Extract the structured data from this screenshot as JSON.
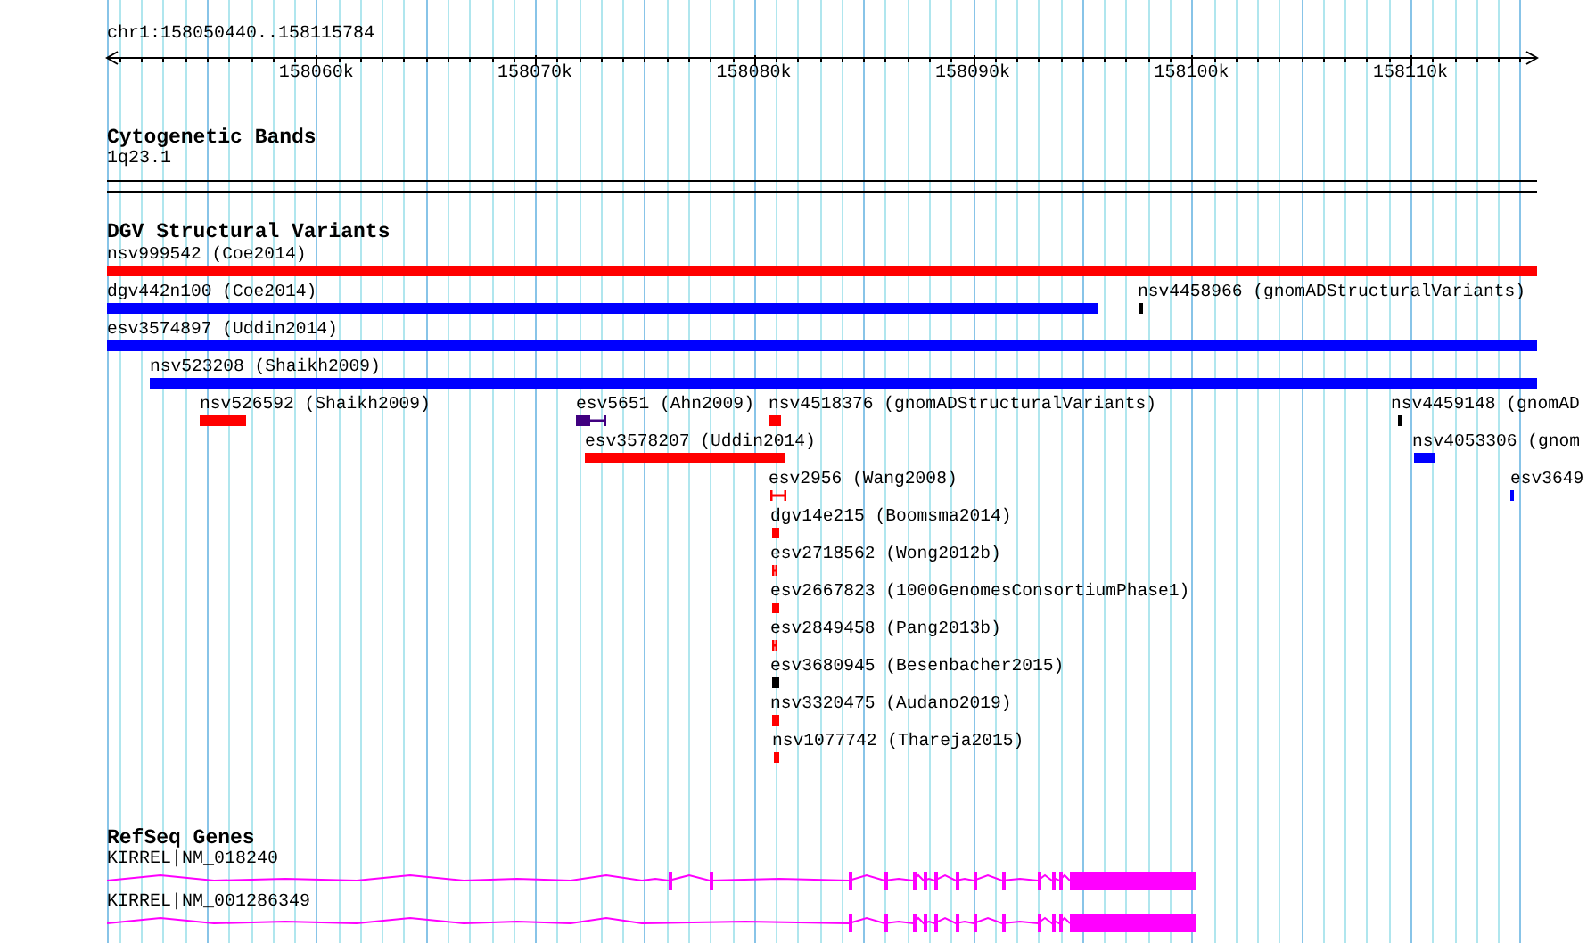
{
  "ruler": {
    "location": "chr1:158050440..158115784",
    "ticks": [
      "158060k",
      "158070k",
      "158080k",
      "158090k",
      "158100k",
      "158110k"
    ]
  },
  "tracks": [
    {
      "title": "Cytogenetic Bands",
      "kind": "bands",
      "features": [
        {
          "label": "1q23.1"
        }
      ]
    },
    {
      "title": "DGV Structural Variants",
      "kind": "variants",
      "features": [
        {
          "label": "nsv999542 (Coe2014)",
          "color": "#ff0000"
        },
        {
          "label": "dgv442n100 (Coe2014)",
          "color": "#0000ff"
        },
        {
          "label": "nsv4458966 (gnomADStructuralVariants)",
          "color": "#000000"
        },
        {
          "label": "esv3574897 (Uddin2014)",
          "color": "#0000ff"
        },
        {
          "label": "nsv523208 (Shaikh2009)",
          "color": "#0000ff"
        },
        {
          "label": "nsv526592 (Shaikh2009)",
          "color": "#ff0000"
        },
        {
          "label": "esv5651 (Ahn2009)",
          "color": "#400080"
        },
        {
          "label": "nsv4518376 (gnomADStructuralVariants)",
          "color": "#ff0000"
        },
        {
          "label": "nsv4459148 (gnomAD",
          "color": "#000000"
        },
        {
          "label": "esv3578207 (Uddin2014)",
          "color": "#ff0000"
        },
        {
          "label": "nsv4053306 (gnom",
          "color": "#0000ff"
        },
        {
          "label": "esv2956 (Wang2008)",
          "color": "#ff0000"
        },
        {
          "label": "esv3649",
          "color": "#0000ff"
        },
        {
          "label": "dgv14e215 (Boomsma2014)",
          "color": "#ff0000"
        },
        {
          "label": "esv2718562 (Wong2012b)",
          "color": "#ff0000"
        },
        {
          "label": "esv2667823 (1000GenomesConsortiumPhase1)",
          "color": "#ff0000"
        },
        {
          "label": "esv2849458 (Pang2013b)",
          "color": "#ff0000"
        },
        {
          "label": "esv3680945 (Besenbacher2015)",
          "color": "#000000"
        },
        {
          "label": "nsv3320475 (Audano2019)",
          "color": "#ff0000"
        },
        {
          "label": "nsv1077742 (Thareja2015)",
          "color": "#ff0000"
        }
      ]
    },
    {
      "title": "RefSeq Genes",
      "kind": "genes",
      "features": [
        {
          "label": "KIRREL|NM_018240"
        },
        {
          "label": "KIRREL|NM_001286349"
        }
      ]
    }
  ]
}
